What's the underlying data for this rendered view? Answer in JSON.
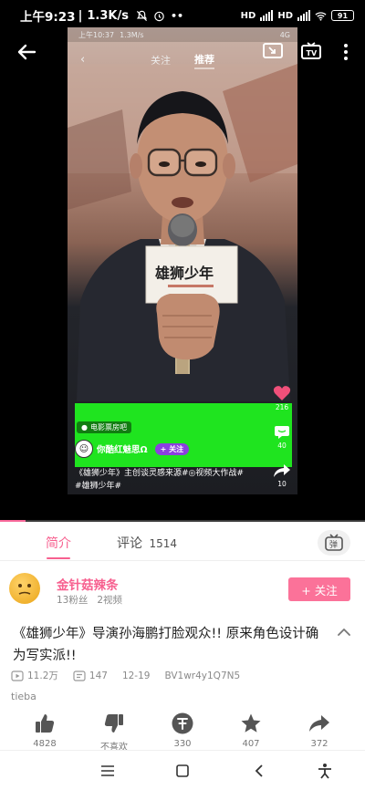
{
  "status_bar": {
    "time": "上午9:23",
    "net_speed": "1.3K/s",
    "network_1": "HD",
    "network_2": "HD",
    "battery": "91"
  },
  "video": {
    "inner_status": {
      "time": "上午10:37",
      "speed": "1.3M/s",
      "battery": "4G"
    },
    "inner_tabs": [
      "关注",
      "推荐"
    ],
    "inner_active_tab": "推荐",
    "banner_tag": "电影票房吧",
    "inner_username": "你酷红魅思Ω",
    "inner_follow": "+ 关注",
    "side_stats": {
      "likes": "216",
      "comments": "40",
      "shares": "10"
    },
    "caption_line1": "《雄狮少年》主创谈灵感来源#◎视频大作战#",
    "caption_line2": "#雄狮少年#",
    "progress_fraction": 0.07
  },
  "tabs": {
    "intro": "简介",
    "comments_label": "评论",
    "comments_count": "1514"
  },
  "danmaku_button_label": "弹",
  "uploader": {
    "name": "金针菇辣条",
    "followers": "13粉丝",
    "videos": "2视频",
    "follow_label": "+ 关注"
  },
  "video_title": "《雄狮少年》导演孙海鹏打脸观众!! 原来角色设计确为写实派!!",
  "stats": {
    "views": "11.2万",
    "danmaku": "147",
    "date": "12-19",
    "bvid": "BV1wr4y1Q7N5"
  },
  "tags": "tieba",
  "actions": {
    "like": "4828",
    "dislike": "不喜欢",
    "coin": "330",
    "favorite": "407",
    "share": "372"
  },
  "colors": {
    "accent_pink": "#fb7299",
    "green_panel": "#1fe41f"
  }
}
